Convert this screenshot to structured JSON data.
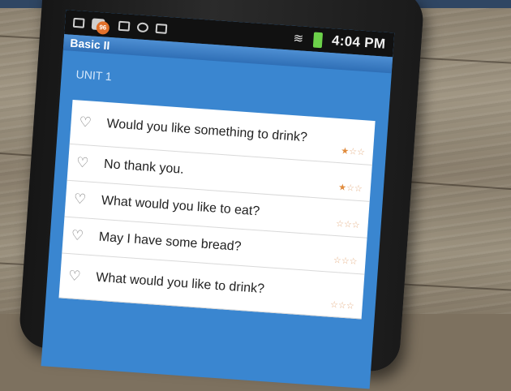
{
  "status_bar": {
    "notification_badge": "96",
    "time": "4:04 PM",
    "icons": [
      "mail-icon",
      "notification-icon",
      "bag-icon",
      "chat-icon",
      "camera-icon",
      "wifi-icon",
      "battery-icon"
    ]
  },
  "app": {
    "title": "Basic II",
    "unit_label": "UNIT 1"
  },
  "phrases": [
    {
      "text": "Would you like something to drink?",
      "rating": 1,
      "max": 3
    },
    {
      "text": "No thank you.",
      "rating": 1,
      "max": 3
    },
    {
      "text": "What would you like to eat?",
      "rating": 0,
      "max": 3
    },
    {
      "text": "May I have some bread?",
      "rating": 0,
      "max": 3
    },
    {
      "text": "What would you like to drink?",
      "rating": 0,
      "max": 3
    }
  ],
  "colors": {
    "accent_blue": "#3a86d0",
    "star_orange": "#e08b3c"
  }
}
